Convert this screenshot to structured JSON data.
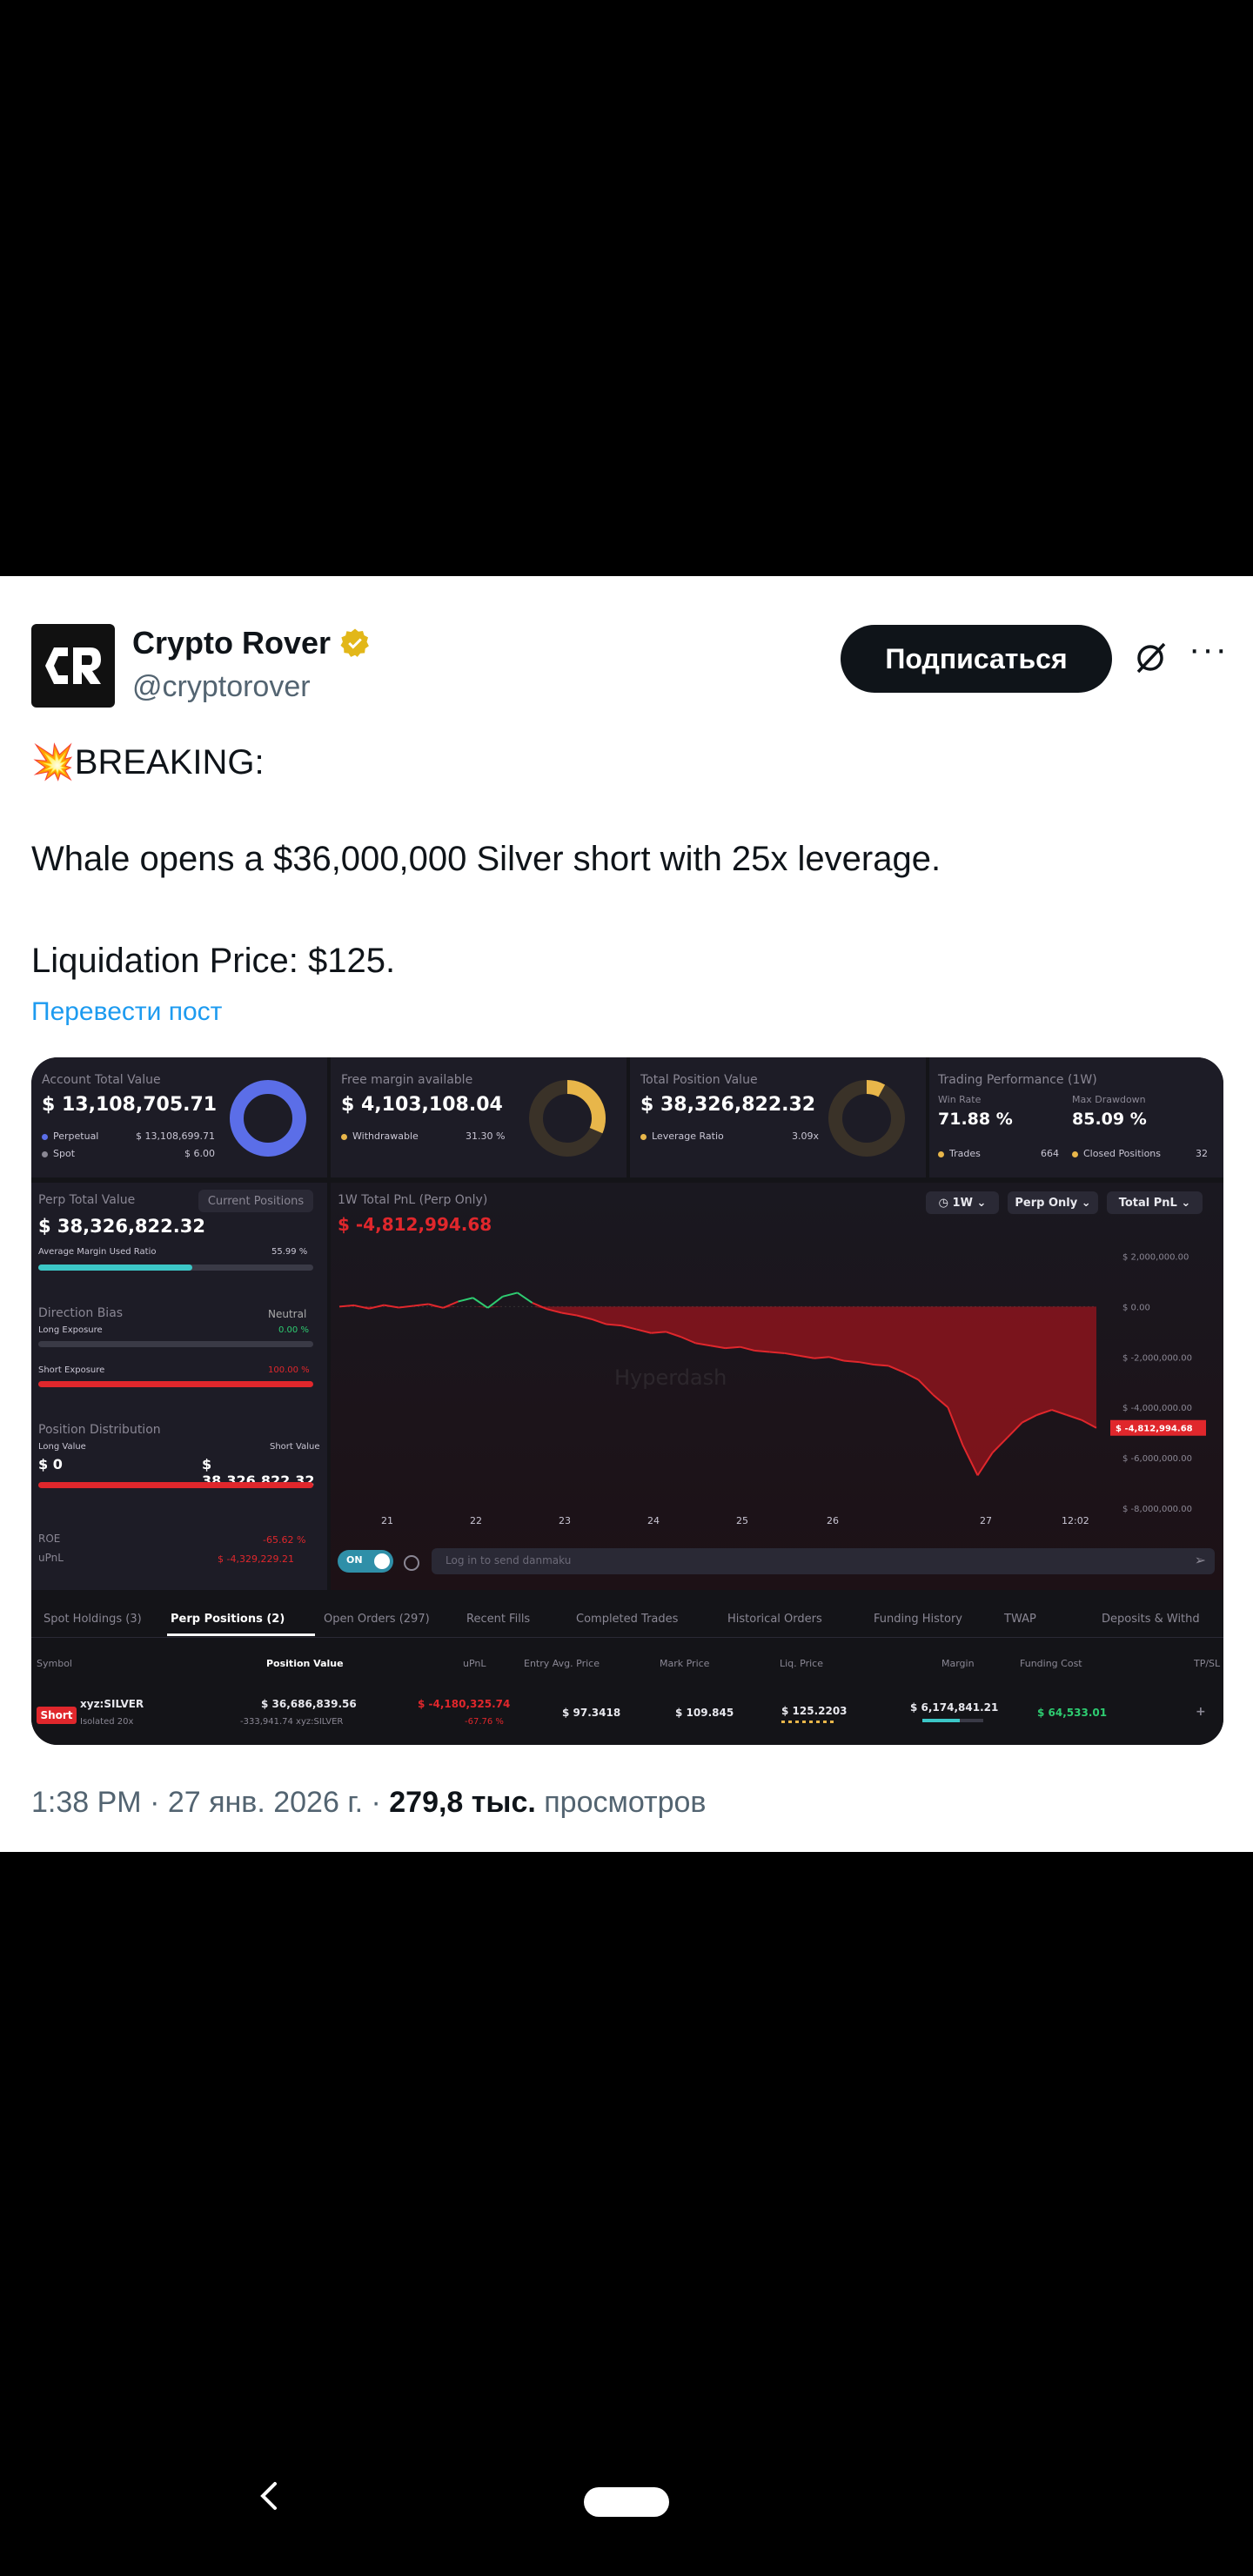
{
  "tweet": {
    "author_name": "Crypto Rover",
    "author_handle": "@cryptorover",
    "follow_label": "Подписаться",
    "more_label": "···",
    "lines": [
      "💥BREAKING:",
      "Whale opens a $36,000,000 Silver short with 25x leverage.",
      "Liquidation Price: $125."
    ],
    "translate_label": "Перевести пост",
    "time": "1:38 PM · 27 янв. 2026 г. · ",
    "views_count": "279,8 тыс.",
    "views_label": " просмотров"
  },
  "dashboard": {
    "account": {
      "label": "Account Total Value",
      "value": "$ 13,108,705.71",
      "perp_label": "Perpetual",
      "perp_value": "$ 13,108,699.71",
      "spot_label": "Spot",
      "spot_value": "$ 6.00"
    },
    "free_margin": {
      "label": "Free margin available",
      "value": "$ 4,103,108.04",
      "withdraw_label": "Withdrawable",
      "withdraw_value": "31.30 %"
    },
    "position": {
      "label": "Total Position Value",
      "value": "$ 38,326,822.32",
      "lev_label": "Leverage Ratio",
      "lev_value": "3.09x"
    },
    "performance": {
      "label": "Trading Performance (1W)",
      "win_label": "Win Rate",
      "win_value": "71.88 %",
      "dd_label": "Max Drawdown",
      "dd_value": "85.09 %",
      "trades_label": "Trades",
      "trades_value": "664",
      "closed_label": "Closed Positions",
      "closed_value": "32"
    },
    "perp": {
      "label": "Perp Total Value",
      "tag": "Current Positions",
      "value": "$ 38,326,822.32",
      "margin_label": "Average Margin Used Ratio",
      "margin_value": "55.99 %",
      "margin_ratio": 0.56,
      "bias_label": "Direction Bias",
      "bias_value": "Neutral",
      "long_label": "Long Exposure",
      "long_value": "0.00 %",
      "short_label": "Short Exposure",
      "short_value": "100.00 %",
      "dist_label": "Position Distribution",
      "long_value_label": "Long Value",
      "long_val": "$ 0",
      "short_value_label": "Short Value",
      "short_val": "$ 38,326,822.32",
      "roe_label": "ROE",
      "roe_value": "-65.62 %",
      "upnl_label": "uPnL",
      "upnl_value": "$ -4,329,229.21"
    },
    "pnl_chart": {
      "title": "1W Total PnL (Perp Only)",
      "value": "$ -4,812,994.68",
      "btn_range": "1W",
      "btn_type": "Perp Only",
      "btn_metric": "Total PnL",
      "toggle_label": "ON",
      "danmaku_placeholder": "Log in to send danmaku",
      "watermark": "Hyperdash",
      "current_label": "$ -4,812,994.68"
    },
    "tabs": [
      "Spot Holdings (3)",
      "Perp Positions (2)",
      "Open Orders (297)",
      "Recent Fills",
      "Completed Trades",
      "Historical Orders",
      "Funding History",
      "TWAP",
      "Deposits & Withd"
    ],
    "table_headers": [
      "Symbol",
      "Position Value",
      "uPnL",
      "Entry Avg. Price",
      "Mark Price",
      "Liq. Price",
      "Margin",
      "Funding Cost",
      "TP/SL"
    ],
    "row": {
      "side": "Short",
      "symbol": "xyz:SILVER",
      "mode": "Isolated 20x",
      "pos_value": "$ 36,686,839.56",
      "pos_size": "-333,941.74 xyz:SILVER",
      "upnl": "$ -4,180,325.74",
      "upnl_pct": "-67.76 %",
      "entry": "$ 97.3418",
      "mark": "$ 109.845",
      "liq": "$ 125.2203",
      "margin": "$ 6,174,841.21",
      "funding": "$ 64,533.01",
      "tpsl": "+"
    },
    "colors": {
      "accent_blue": "#5b6ee8",
      "gold": "#e8b64a",
      "red": "#e0272c",
      "green": "#2ecc71",
      "teal": "#3cc7c7"
    }
  },
  "chart_data": {
    "type": "line",
    "title": "1W Total PnL (Perp Only)",
    "x": [
      "21",
      "22",
      "23",
      "24",
      "25",
      "26",
      "27",
      "12:02"
    ],
    "y_ticks": [
      "$ 2,000,000.00",
      "$ 0.00",
      "$ -2,000,000.00",
      "$ -4,000,000.00",
      "$ -6,000,000.00",
      "$ -8,000,000.00"
    ],
    "ylim": [
      -8000000,
      2500000
    ],
    "series": [
      {
        "values": [
          0,
          50000,
          -80000,
          60000,
          -40000,
          30000,
          100000,
          -50000,
          200000,
          350000,
          -50000,
          400000,
          550000,
          150000,
          -100000,
          -250000,
          -350000,
          -500000,
          -700000,
          -750000,
          -900000,
          -1050000,
          -1000000,
          -1200000,
          -1450000,
          -1550000,
          -1650000,
          -1600000,
          -1750000,
          -1800000,
          -1850000,
          -1950000,
          -2050000,
          -2000000,
          -2150000,
          -2200000,
          -2300000,
          -2350000,
          -2600000,
          -2900000,
          -3500000,
          -4000000,
          -5500000,
          -6700000,
          -5800000,
          -5200000,
          -4600000,
          -4300000,
          -4100000,
          -4300000,
          -4500000,
          -4813000
        ]
      }
    ]
  }
}
